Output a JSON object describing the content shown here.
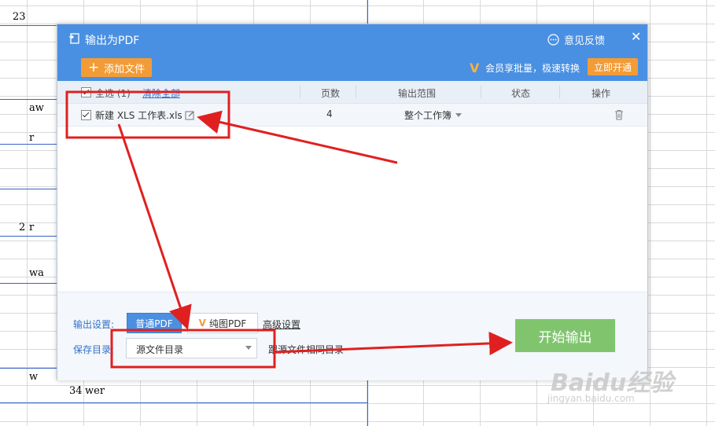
{
  "sheet": {
    "cells": [
      "23",
      "aw",
      "r",
      "2",
      "r",
      "wa",
      "w",
      "34",
      "wer"
    ]
  },
  "dialog": {
    "title": "输出为PDF",
    "feedback": "意见反馈",
    "close": "✕",
    "add_file": "添加文件",
    "vip_text": "会员享批量，极速转换",
    "open_now": "立即开通"
  },
  "table": {
    "select_all": "全选 (1)",
    "clear_all": "清除全部",
    "headers": {
      "pages": "页数",
      "range": "输出范围",
      "status": "状态",
      "action": "操作"
    },
    "rows": [
      {
        "name": "新建 XLS 工作表.xls",
        "pages": "4",
        "range": "整个工作簿",
        "status": ""
      }
    ]
  },
  "footer": {
    "output_settings_label": "输出设置:",
    "normal_pdf": "普通PDF",
    "image_pdf": "纯图PDF",
    "advanced": "高级设置",
    "save_dir_label": "保存目录:",
    "save_dir_value": "源文件目录",
    "same_dir_hint": "跟源文件相同目录",
    "start": "开始输出"
  },
  "watermark": {
    "brand": "Baidu经验",
    "url": "jingyan.baidu.com"
  },
  "colors": {
    "title_bar": "#4a90e2",
    "accent_orange": "#f29c38",
    "start_green": "#80c56e",
    "annotation_red": "#e02020"
  }
}
